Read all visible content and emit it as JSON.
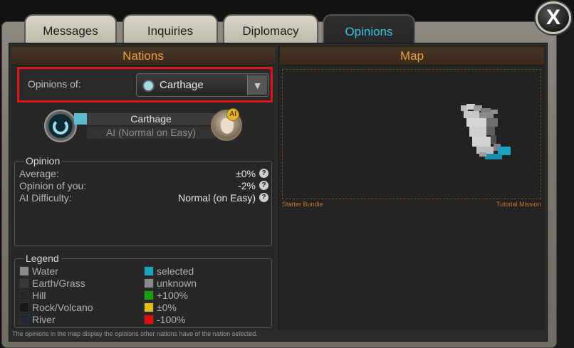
{
  "tabs": [
    {
      "label": "Messages"
    },
    {
      "label": "Inquiries"
    },
    {
      "label": "Diplomacy"
    },
    {
      "label": "Opinions"
    }
  ],
  "active_tab": "Opinions",
  "close_label": "X",
  "nations": {
    "header": "Nations",
    "opinions_of_label": "Opinions of:",
    "selected_nation": "Carthage",
    "nation_card": {
      "name": "Carthage",
      "ai_status": "AI (Normal on Easy)",
      "badge": "AI",
      "color": "#59bcd0"
    }
  },
  "opinion": {
    "title": "Opinion",
    "rows": [
      {
        "label": "Average:",
        "value": "±0%"
      },
      {
        "label": "Opinion of you:",
        "value": "-2%"
      },
      {
        "label": "AI Difficulty:",
        "value": "Normal (on Easy)"
      }
    ]
  },
  "legend": {
    "title": "Legend",
    "left": [
      {
        "label": "Water",
        "color": "#8c8c8c"
      },
      {
        "label": "Earth/Grass",
        "color": "#3a3a3a"
      },
      {
        "label": "Hill",
        "color": "#262626"
      },
      {
        "label": "Rock/Volcano",
        "color": "#161616"
      },
      {
        "label": "River",
        "color": "#1e2a36"
      }
    ],
    "right": [
      {
        "label": "selected",
        "color": "#1ba4c2"
      },
      {
        "label": "unknown",
        "color": "#8a8a8a"
      },
      {
        "label": "+100%",
        "color": "#13a013"
      },
      {
        "label": "±0%",
        "color": "#e0c012"
      },
      {
        "label": "-100%",
        "color": "#e01010"
      }
    ]
  },
  "footnote": "The opinions in the map display the opinions other nations have of the nation selected.",
  "map": {
    "header": "Map",
    "caption_left": "Starter Bundle",
    "caption_right": "Tutorial Mission"
  },
  "accent_colors": {
    "active_tab_text": "#39c5e0",
    "header_text": "#f0a040",
    "highlight_border": "#e0161f"
  }
}
